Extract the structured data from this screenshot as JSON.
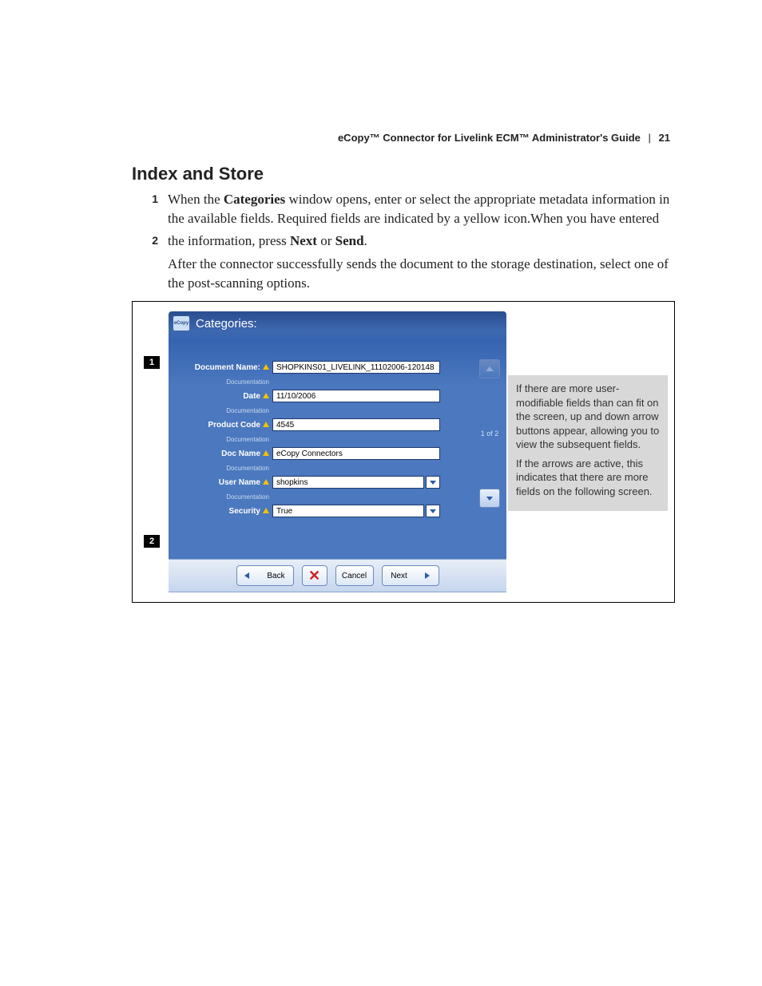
{
  "header": {
    "doc_title": "eCopy™ Connector for Livelink ECM™ Administrator's Guide",
    "separator": "|",
    "page_number": "21"
  },
  "section_title": "Index and Store",
  "steps": [
    {
      "num": "1",
      "pre": "When the ",
      "bold1": "Categories",
      "post": " window opens, enter or select the appropriate metadata information in the available fields. Required fields are indicated by a yellow icon.When you have entered"
    },
    {
      "num": "2",
      "pre": "the information, press ",
      "bold1": "Next",
      "mid": " or ",
      "bold2": "Send",
      "post": ".",
      "follow": "After the connector successfully sends the document to the storage destination, select one of the post-scanning options."
    }
  ],
  "ui": {
    "logo_text": "eCopy",
    "title": "Categories:",
    "hint": "Documentation",
    "fields": [
      {
        "label": "Document Name:",
        "value": "SHOPKINS01_LIVELINK_11102006-120148",
        "dropdown": false
      },
      {
        "label": "Date",
        "value": "11/10/2006",
        "dropdown": false
      },
      {
        "label": "Product Code",
        "value": "4545",
        "dropdown": false
      },
      {
        "label": "Doc Name",
        "value": "eCopy Connectors",
        "dropdown": false
      },
      {
        "label": "User Name",
        "value": "shopkins",
        "dropdown": true
      },
      {
        "label": "Security",
        "value": "True",
        "dropdown": true
      }
    ],
    "page_indicator": "1 of 2",
    "buttons": {
      "back": "Back",
      "cancel": "Cancel",
      "next": "Next"
    }
  },
  "callouts": {
    "one": "1",
    "two": "2"
  },
  "sidenote": {
    "p1": "If there are more user-modifiable fields than can fit on the screen, up and down arrow buttons appear, allowing you to view the subsequent fields.",
    "p2": "If the arrows are active, this indicates that there are more fields on the following screen."
  }
}
